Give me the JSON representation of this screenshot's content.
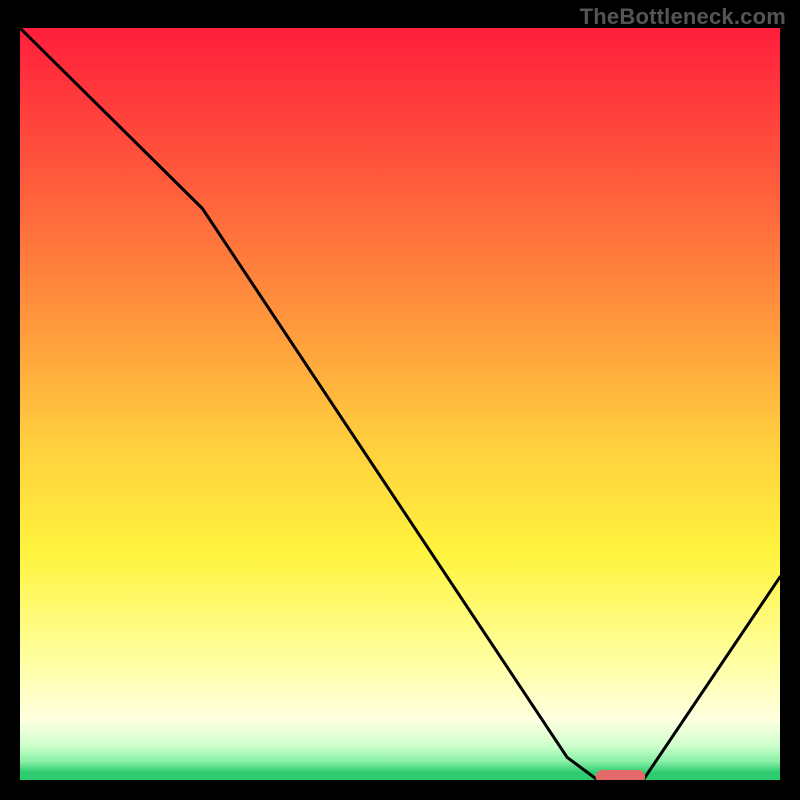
{
  "attribution": "TheBottleneck.com",
  "colors": {
    "frame": "#000000",
    "curve": "#000000",
    "marker_fill": "#E46A6A",
    "gradient_stops": [
      {
        "offset": 0.0,
        "color": "#FF1E3C"
      },
      {
        "offset": 0.2,
        "color": "#FF5A3C"
      },
      {
        "offset": 0.4,
        "color": "#FF9A3C"
      },
      {
        "offset": 0.55,
        "color": "#FFCE3E"
      },
      {
        "offset": 0.7,
        "color": "#FFF43E"
      },
      {
        "offset": 0.84,
        "color": "#FFFFA0"
      },
      {
        "offset": 0.92,
        "color": "#FFFFE0"
      },
      {
        "offset": 0.955,
        "color": "#CCFFCC"
      },
      {
        "offset": 0.975,
        "color": "#8AF0A6"
      },
      {
        "offset": 0.99,
        "color": "#2ECC71"
      },
      {
        "offset": 1.0,
        "color": "#2ECC71"
      }
    ]
  },
  "chart_data": {
    "type": "line",
    "title": "",
    "xlabel": "",
    "ylabel": "",
    "xlim": [
      0,
      100
    ],
    "ylim": [
      0,
      100
    ],
    "series": [
      {
        "name": "curve",
        "x": [
          0,
          24,
          72,
          76,
          82,
          100
        ],
        "y": [
          100,
          76,
          3,
          0,
          0,
          27
        ]
      }
    ],
    "marker": {
      "x_start": 76,
      "x_end": 82,
      "y": 0
    },
    "grid": false,
    "legend": false
  }
}
